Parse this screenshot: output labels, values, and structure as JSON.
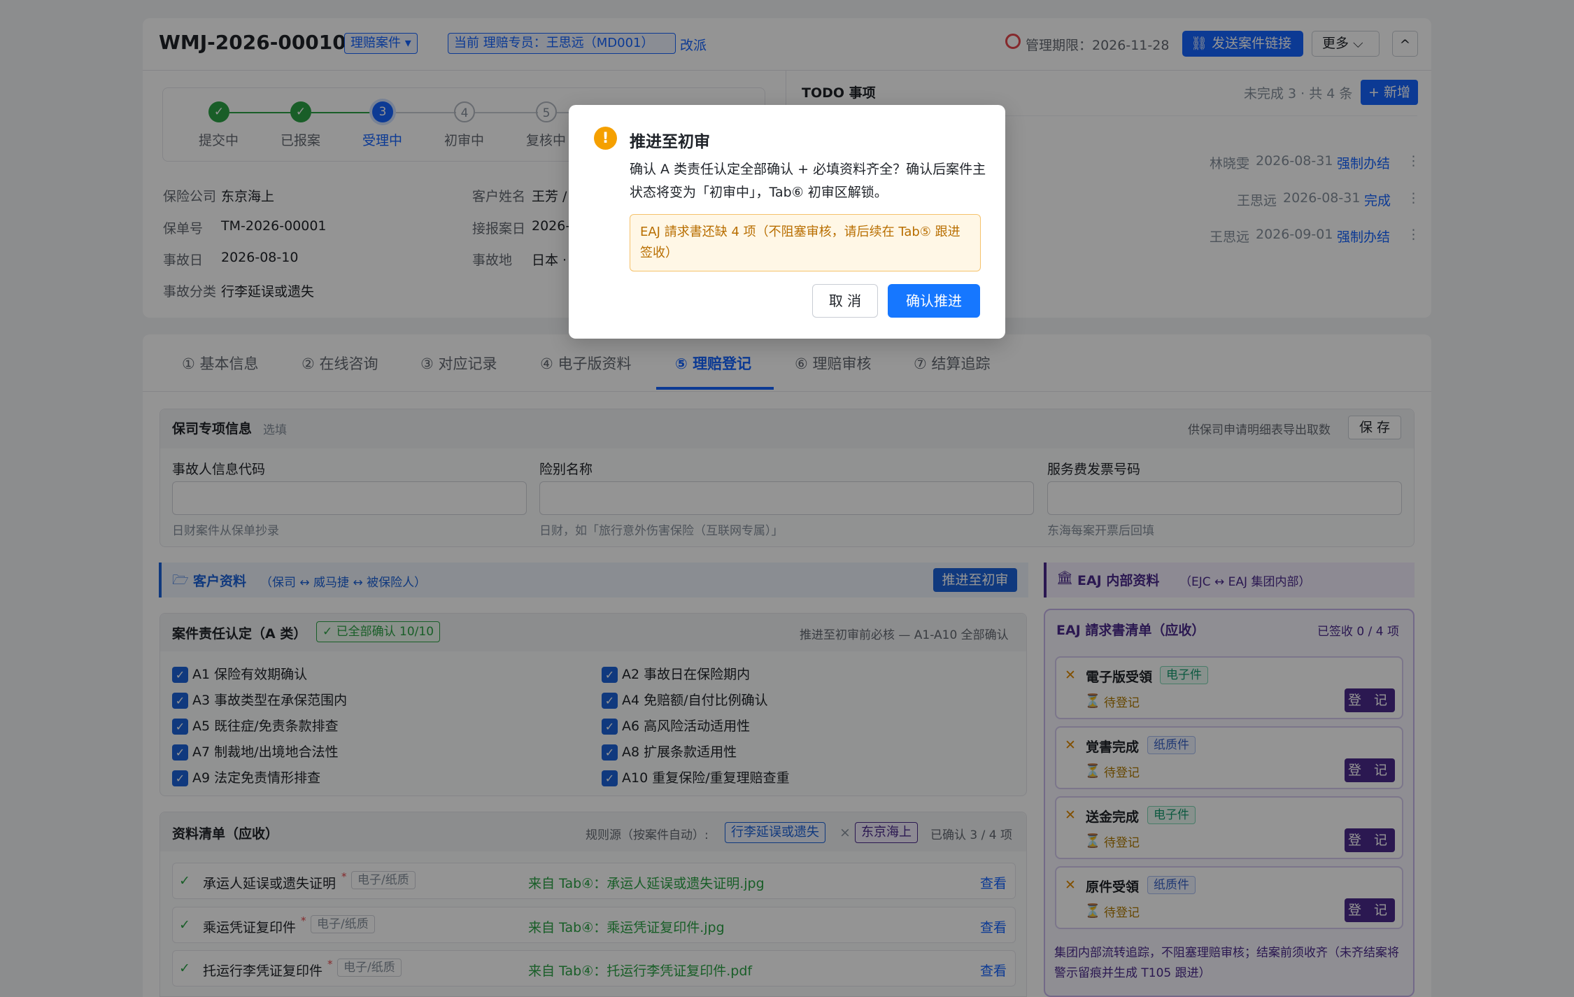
{
  "header": {
    "case_id": "WMJ-2026-00010",
    "case_type": "理赔案件 ▾",
    "assignee": "当前 理赔专员：王思远（MD001）",
    "reassign": "改派",
    "deadline": "管理期限：2026-11-28",
    "send_link": "发送案件链接",
    "more": "更多",
    "collapse": "^"
  },
  "steps": [
    {
      "num": "✓",
      "label": "提交中"
    },
    {
      "num": "✓",
      "label": "已报案"
    },
    {
      "num": "3",
      "label": "受理中"
    },
    {
      "num": "4",
      "label": "初审中"
    },
    {
      "num": "5",
      "label": "复核中"
    }
  ],
  "info": {
    "insurer_label": "保险公司",
    "insurer": "东京海上",
    "customer_label": "客户姓名",
    "customer": "王芳 /",
    "policy_label": "保单号",
    "policy": "TM-2026-00001",
    "report_date_label": "接报案日",
    "report_date": "2026-",
    "accident_date_label": "事故日",
    "accident_date": "2026-08-10",
    "accident_place_label": "事故地",
    "accident_place": "日本 ·",
    "category_label": "事故分类",
    "category": "行李延误或遗失"
  },
  "todo": {
    "title": "TODO 事项",
    "summary": "未完成 3 · 共 4 条",
    "add": "+ 新增",
    "items": [
      {
        "person": "林晓雯",
        "date": "2026-08-31",
        "action": "强制办结"
      },
      {
        "person": "王思远",
        "date": "2026-08-31",
        "action": "完成"
      },
      {
        "person": "王思远",
        "date": "2026-09-01",
        "action": "强制办结"
      }
    ]
  },
  "tabs": [
    "① 基本信息",
    "② 在线咨询",
    "③ 对应记录",
    "④ 电子版资料",
    "⑤ 理赔登记",
    "⑥ 理赔审核",
    "⑦ 结算追踪"
  ],
  "insurer_section": {
    "title": "保司专项信息",
    "optional": "选填",
    "export_hint": "供保司申请明细表导出取数",
    "save": "保 存",
    "fields": [
      {
        "label": "事故人信息代码",
        "hint": "日财案件从保单抄录"
      },
      {
        "label": "险别名称",
        "hint": "日财，如「旅行意外伤害保险（互联网专属）」"
      },
      {
        "label": "服务费发票号码",
        "hint": "东海每案开票后回填"
      }
    ]
  },
  "customer_section": {
    "title": "客户资料",
    "subtitle": "（保司 ↔ 威马捷 ↔ 被保险人）",
    "advance": "推进至初审"
  },
  "liability": {
    "title": "案件责任认定（A 类）",
    "badge": "✓ 已全部确认 10/10",
    "note": "推进至初审前必核 — A1-A10 全部确认",
    "items": [
      "A1 保险有效期确认",
      "A2 事故日在保险期内",
      "A3 事故类型在承保范围内",
      "A4 免赔额/自付比例确认",
      "A5 既往症/免责条款排查",
      "A6 高风险活动适用性",
      "A7 制裁地/出境地合法性",
      "A8 扩展条款适用性",
      "A9 法定免责情形排查",
      "A10 重复保险/重复理赔查重"
    ]
  },
  "docs": {
    "title": "资料清单（应收）",
    "rule_label": "规则源（按案件自动）:",
    "rule_tag1": "行李延误或遗失",
    "rule_x": "×",
    "rule_tag2": "东京海上",
    "confirmed": "已确认 3 / 4 项",
    "items": [
      {
        "name": "承运人延误或遗失证明",
        "type": "电子/纸质",
        "source": "来自 Tab④：承运人延误或遗失证明.jpg",
        "view": "查看"
      },
      {
        "name": "乘运凭证复印件",
        "type": "电子/纸质",
        "source": "来自 Tab④：乘运凭证复印件.jpg",
        "view": "查看"
      },
      {
        "name": "托运行李凭证复印件",
        "type": "电子/纸质",
        "source": "来自 Tab④：托运行李凭证复印件.pdf",
        "view": "查看"
      }
    ]
  },
  "eaj": {
    "title": "EAJ 内部资料",
    "subtitle": "（EJC ↔ EAJ 集团内部）",
    "list_title": "EAJ 請求書清单（应收）",
    "signed": "已签收 0 / 4 项",
    "items": [
      {
        "name": "電子版受領",
        "type": "电子件",
        "status": "待登记",
        "btn": "登 记"
      },
      {
        "name": "覚書完成",
        "type": "纸质件",
        "status": "待登记",
        "btn": "登 记"
      },
      {
        "name": "送金完成",
        "type": "电子件",
        "status": "待登记",
        "btn": "登 记"
      },
      {
        "name": "原件受領",
        "type": "纸质件",
        "status": "待登记",
        "btn": "登 记"
      }
    ],
    "footer": "集团内部流转追踪，不阻塞理赔审核；结案前须收齐（未齐结案将警示留痕并生成 T105 跟进）"
  },
  "modal": {
    "title": "推进至初审",
    "body": "确认 A 类责任认定全部确认 + 必填资料齐全？确认后案件主状态将变为「初审中」，Tab⑥ 初审区解锁。",
    "warning": "EAJ 請求書还缺 4 项（不阻塞审核，请后续在 Tab⑤ 跟进签收）",
    "cancel": "取 消",
    "confirm": "确认推进"
  },
  "colors": {
    "primary": "#1664ff",
    "success": "#2ba245",
    "purple": "#4a2a8c",
    "warning_bg": "#fff7e6",
    "overlay": "rgba(0,0,0,0.42)"
  }
}
